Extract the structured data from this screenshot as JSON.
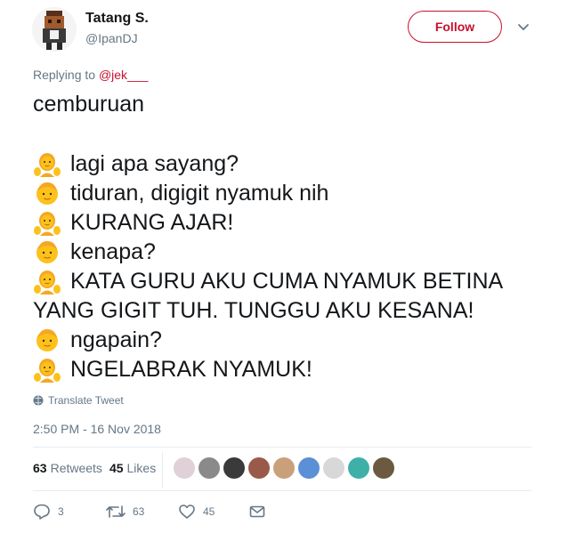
{
  "author": {
    "display_name": "Tatang S.",
    "handle": "@IpanDJ",
    "avatar_icon": "pixel-character-avatar"
  },
  "follow_label": "Follow",
  "colors": {
    "accent": "#c8102e",
    "secondary_text": "#657786",
    "primary_text": "#14171a",
    "divider": "#e6ecf0"
  },
  "reply": {
    "prefix": "Replying to",
    "mention": "@jek___"
  },
  "tweet": {
    "first_line": "cemburuan",
    "lines": [
      {
        "emoji": "person-with-raised-hands-emoji",
        "text": "lagi apa sayang?"
      },
      {
        "emoji": "boy-face-emoji",
        "text": "tiduran, digigit nyamuk nih"
      },
      {
        "emoji": "person-with-raised-hands-emoji",
        "text": "KURANG AJAR!"
      },
      {
        "emoji": "boy-face-emoji",
        "text": "kenapa?"
      },
      {
        "emoji": "person-with-raised-hands-emoji",
        "text": "KATA GURU AKU CUMA NYAMUK BETINA"
      },
      {
        "emoji": "",
        "text": "YANG GIGIT TUH. TUNGGU AKU KESANA!"
      },
      {
        "emoji": "boy-face-emoji",
        "text": "ngapain?"
      },
      {
        "emoji": "person-with-raised-hands-emoji",
        "text": "NGELABRAK NYAMUK!"
      }
    ]
  },
  "translate_label": "Translate Tweet",
  "timestamp": "2:50 PM - 16 Nov 2018",
  "stats": {
    "retweets_count": "63",
    "retweets_label": "Retweets",
    "likes_count": "45",
    "likes_label": "Likes"
  },
  "likers": [
    "#e0d0d8",
    "#8a8a8a",
    "#3a3a3a",
    "#9a5a4a",
    "#c9a07a",
    "#5b8fd6",
    "#d8d8d8",
    "#3fb0a8",
    "#6b5a40"
  ],
  "actions": {
    "replies": "3",
    "retweets": "63",
    "likes": "45"
  }
}
